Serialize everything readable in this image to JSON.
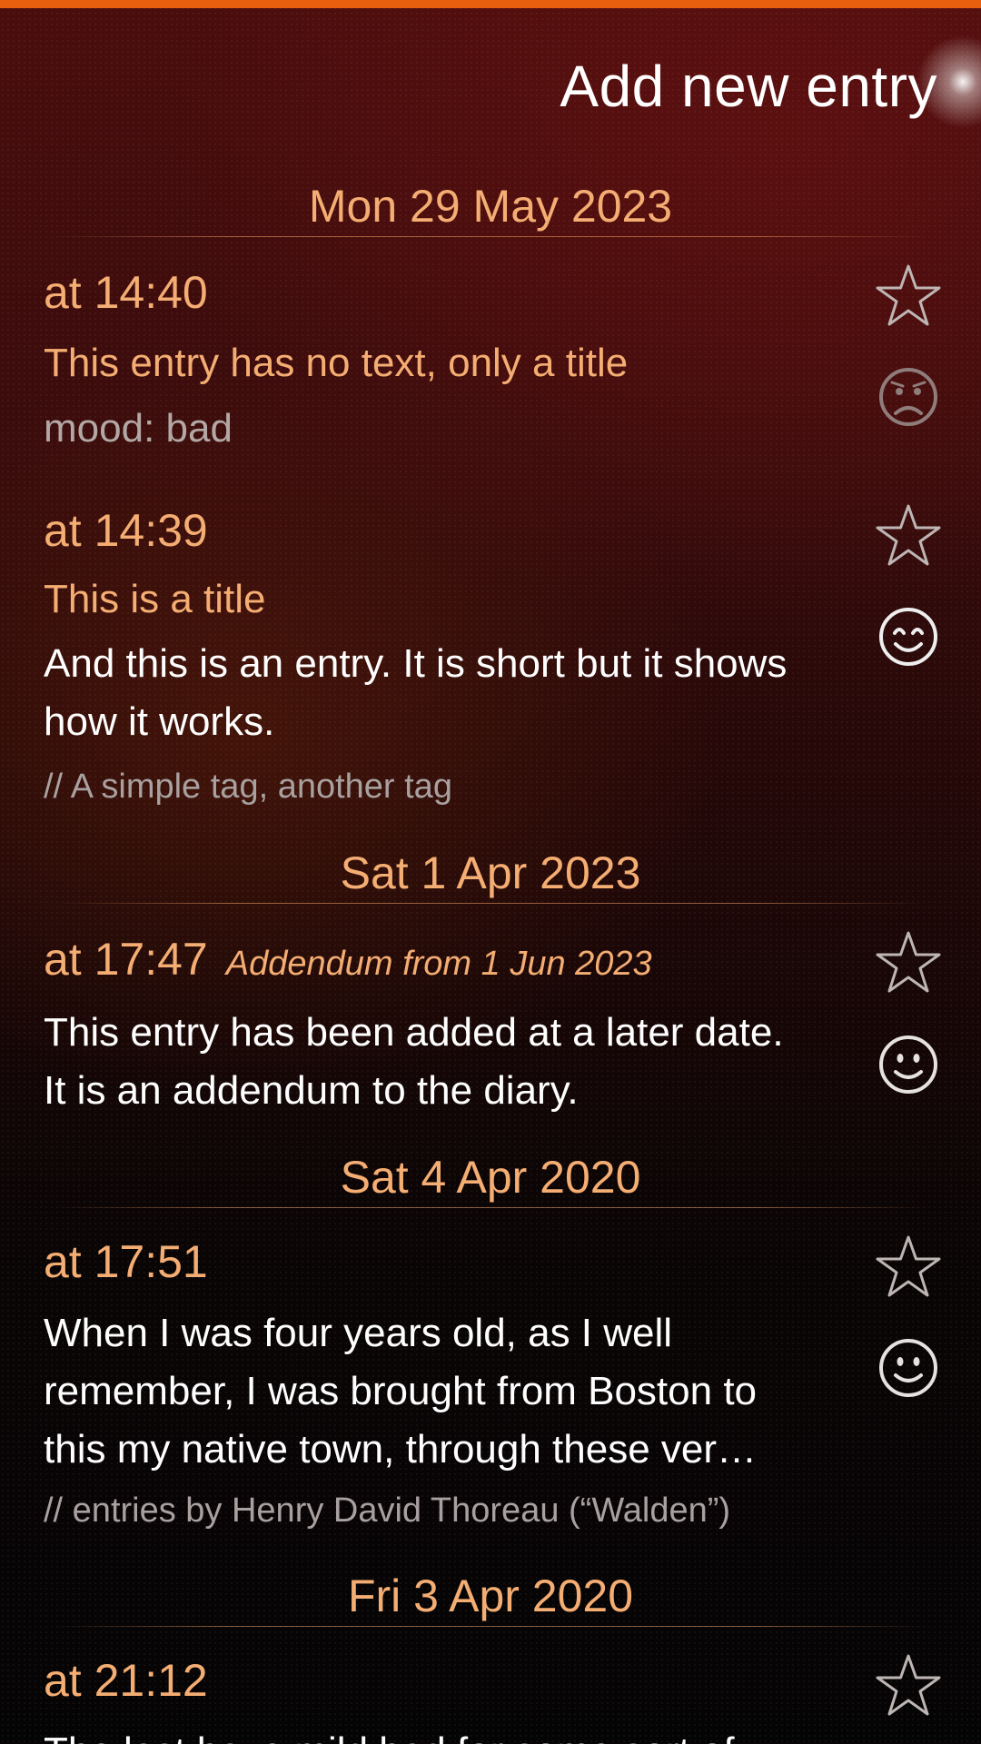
{
  "header": {
    "add_entry_label": "Add new entry"
  },
  "sections": [
    {
      "date": "Mon 29 May 2023",
      "entries": [
        {
          "time": "at 14:40",
          "title": "This entry has no text, only a title",
          "mood_text": "mood: bad",
          "mood_icon": "sad-face-icon",
          "favorite_icon": "star-outline-icon"
        },
        {
          "time": "at 14:39",
          "title": "This is a title",
          "text_lines": [
            "And this is an entry. It is short but it shows",
            "how it works."
          ],
          "tags": "// A simple tag, another tag",
          "mood_icon": "happy-face-icon",
          "favorite_icon": "star-outline-icon"
        }
      ]
    },
    {
      "date": "Sat 1 Apr 2023",
      "entries": [
        {
          "time": "at 17:47",
          "addendum": "Addendum from 1 Jun 2023",
          "text_lines": [
            "This entry has been added at a later date.",
            "It is an addendum to the diary."
          ],
          "mood_icon": "smile-face-icon",
          "favorite_icon": "star-outline-icon"
        }
      ]
    },
    {
      "date": "Sat 4 Apr 2020",
      "entries": [
        {
          "time": "at 17:51",
          "text_lines": [
            "When I was four years old, as I well",
            "remember, I was brought from Boston to",
            "this my native town, through these ver…"
          ],
          "tags": "// entries by Henry David Thoreau (“Walden”)",
          "mood_icon": "smile-face-icon",
          "favorite_icon": "star-outline-icon"
        }
      ]
    },
    {
      "date": "Fri 3 Apr 2020",
      "entries": [
        {
          "time": "at 21:12",
          "text_lines": [
            "The last have mild bad for some sort of"
          ],
          "favorite_icon": "star-outline-icon"
        }
      ]
    }
  ],
  "colors": {
    "accent": "#e8600e",
    "date_text": "#f4ad72",
    "body_text": "#ffffff",
    "secondary_text": "#a9a0a0"
  }
}
